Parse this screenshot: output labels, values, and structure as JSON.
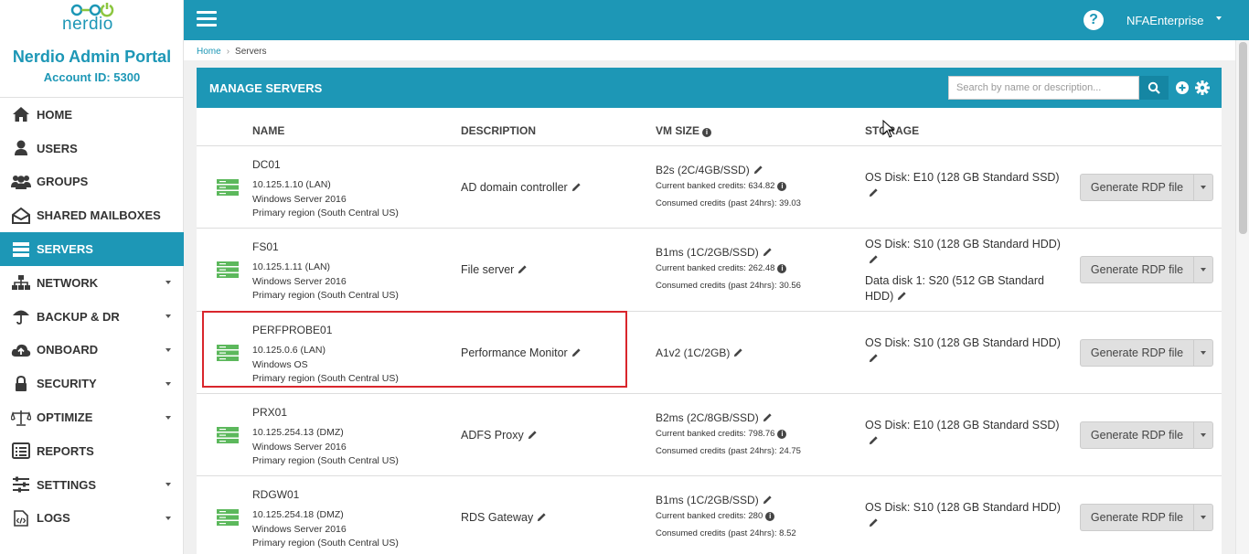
{
  "sidebar": {
    "logo_text": "nerdio",
    "portal_title": "Nerdio Admin Portal",
    "account_id": "Account ID: 5300",
    "items": [
      {
        "label": "HOME",
        "icon": "home-icon",
        "active": false,
        "has_caret": false
      },
      {
        "label": "USERS",
        "icon": "user-icon",
        "active": false,
        "has_caret": false
      },
      {
        "label": "GROUPS",
        "icon": "users-icon",
        "active": false,
        "has_caret": false
      },
      {
        "label": "SHARED MAILBOXES",
        "icon": "envelope-open-icon",
        "active": false,
        "has_caret": false
      },
      {
        "label": "SERVERS",
        "icon": "server-icon",
        "active": true,
        "has_caret": false
      },
      {
        "label": "NETWORK",
        "icon": "sitemap-icon",
        "active": false,
        "has_caret": true
      },
      {
        "label": "BACKUP & DR",
        "icon": "umbrella-icon",
        "active": false,
        "has_caret": true
      },
      {
        "label": "ONBOARD",
        "icon": "cloud-upload-icon",
        "active": false,
        "has_caret": true
      },
      {
        "label": "SECURITY",
        "icon": "lock-icon",
        "active": false,
        "has_caret": true
      },
      {
        "label": "OPTIMIZE",
        "icon": "balance-scale-icon",
        "active": false,
        "has_caret": true
      },
      {
        "label": "REPORTS",
        "icon": "list-alt-icon",
        "active": false,
        "has_caret": false
      },
      {
        "label": "SETTINGS",
        "icon": "sliders-icon",
        "active": false,
        "has_caret": true
      },
      {
        "label": "LOGS",
        "icon": "file-code-icon",
        "active": false,
        "has_caret": true
      }
    ]
  },
  "topbar": {
    "user_name": "NFAEnterprise",
    "help_glyph": "?"
  },
  "breadcrumb": {
    "home": "Home",
    "separator": "›",
    "current": "Servers"
  },
  "panel": {
    "title": "MANAGE SERVERS",
    "search_placeholder": "Search by name or description..."
  },
  "table": {
    "headers": {
      "name": "NAME",
      "description": "DESCRIPTION",
      "vm_size": "VM SIZE",
      "storage": "STORAGE"
    },
    "rdp_label": "Generate RDP file",
    "rows": [
      {
        "name": "DC01",
        "ip": "10.125.1.10 (LAN)",
        "os": "Windows Server 2016",
        "region": "Primary region (South Central US)",
        "description": "AD domain controller",
        "vm_size": "B2s (2C/4GB/SSD)",
        "banked": "Current banked credits: 634.82",
        "consumed": "Consumed credits (past 24hrs): 39.03",
        "storage": [
          "OS Disk: E10 (128 GB Standard SSD)"
        ]
      },
      {
        "name": "FS01",
        "ip": "10.125.1.11 (LAN)",
        "os": "Windows Server 2016",
        "region": "Primary region (South Central US)",
        "description": "File server",
        "vm_size": "B1ms (1C/2GB/SSD)",
        "banked": "Current banked credits: 262.48",
        "consumed": "Consumed credits (past 24hrs): 30.56",
        "storage": [
          "OS Disk: S10 (128 GB Standard HDD)",
          "Data disk 1: S20 (512 GB Standard HDD)"
        ]
      },
      {
        "name": "PERFPROBE01",
        "ip": "10.125.0.6 (LAN)",
        "os": "Windows OS",
        "region": "Primary region (South Central US)",
        "description": "Performance Monitor",
        "vm_size": "A1v2 (1C/2GB)",
        "banked": "",
        "consumed": "",
        "storage": [
          "OS Disk: S10 (128 GB Standard HDD)"
        ]
      },
      {
        "name": "PRX01",
        "ip": "10.125.254.13 (DMZ)",
        "os": "Windows Server 2016",
        "region": "Primary region (South Central US)",
        "description": "ADFS Proxy",
        "vm_size": "B2ms (2C/8GB/SSD)",
        "banked": "Current banked credits: 798.76",
        "consumed": "Consumed credits (past 24hrs): 24.75",
        "storage": [
          "OS Disk: E10 (128 GB Standard SSD)"
        ]
      },
      {
        "name": "RDGW01",
        "ip": "10.125.254.18 (DMZ)",
        "os": "Windows Server 2016",
        "region": "Primary region (South Central US)",
        "description": "RDS Gateway",
        "vm_size": "B1ms (1C/2GB/SSD)",
        "banked": "Current banked credits: 280",
        "consumed": "Consumed credits (past 24hrs): 8.52",
        "storage": [
          "OS Disk: S10 (128 GB Standard HDD)"
        ]
      }
    ]
  },
  "colors": {
    "brand": "#1d97b6",
    "server_icon": "#5cb85c",
    "highlight": "#d9262c"
  }
}
